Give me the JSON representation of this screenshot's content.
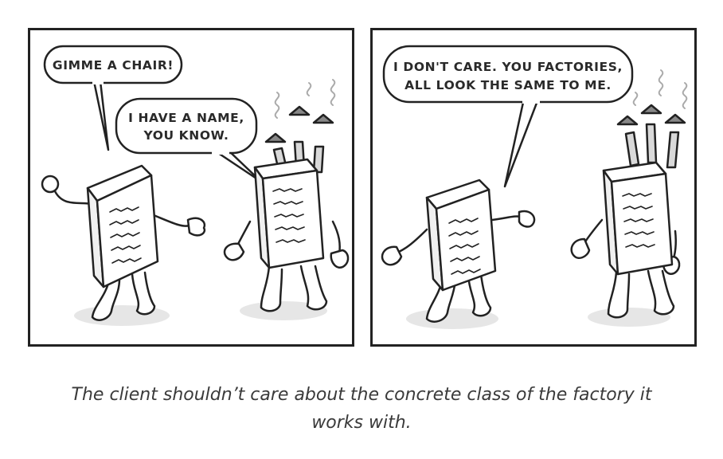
{
  "panels": [
    {
      "bubbles": [
        {
          "lines": [
            "GIMME A CHAIR!"
          ]
        },
        {
          "lines": [
            "I HAVE A NAME,",
            "YOU KNOW."
          ]
        }
      ]
    },
    {
      "bubbles": [
        {
          "lines": [
            "I DON'T CARE. YOU FACTORIES,",
            "ALL LOOK THE SAME TO ME."
          ]
        }
      ]
    }
  ],
  "caption": {
    "line1": "The client shouldn’t care about the concrete class of the factory it",
    "line2": "works with."
  }
}
